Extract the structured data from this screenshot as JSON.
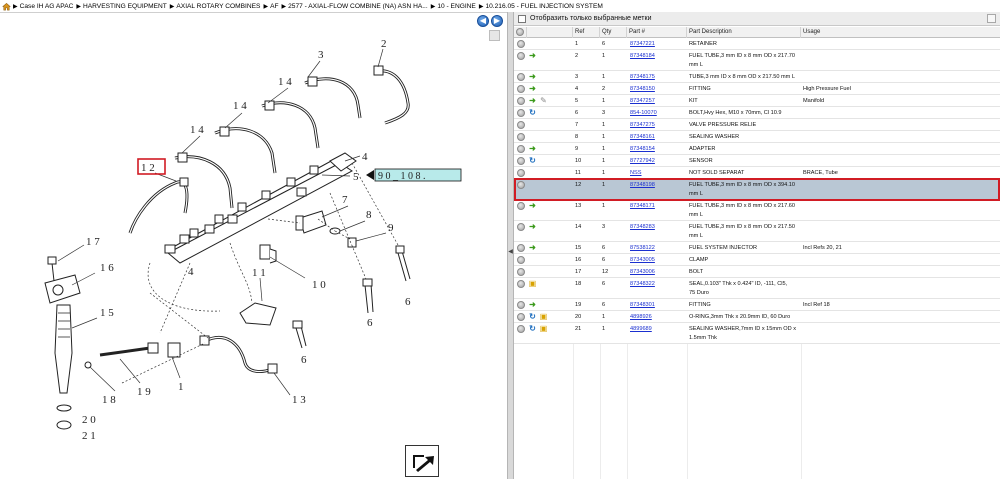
{
  "breadcrumb": {
    "items": [
      "Case IH AG APAC",
      "HARVESTING EQUIPMENT",
      "AXIAL ROTARY COMBINES",
      "AF",
      "2577 - AXIAL-FLOW COMBINE (NA) ASN HA...",
      "10 - ENGINE",
      "10.216.05 - FUEL INJECTION SYSTEM"
    ]
  },
  "diagram": {
    "callouts": {
      "c3": "3",
      "c2": "2",
      "c14a": "1 4",
      "c14b": "1 4",
      "c14c": "1 4",
      "c12": "1 2",
      "c5": "5",
      "c4a": "4",
      "c4b": "4",
      "c7": "7",
      "c8": "8",
      "c9": "9",
      "c17": "1 7",
      "c16": "1 6",
      "c15": "1 5",
      "c11": "1 1",
      "c10": "1 0",
      "c6a": "6",
      "c6b": "6",
      "c6c": "6",
      "c1": "1",
      "c19": "1 9",
      "c18": "1 8",
      "c13": "1 3",
      "c20": "2 0",
      "c21": "2 1"
    },
    "tag_label": "9 0 _ 1 0 8 .",
    "highlight_color": "#d11c24",
    "tag_fill": "#b8eaea"
  },
  "filter": {
    "label": "Отобразить только выбранные метки"
  },
  "table": {
    "columns": [
      "Ref",
      "Qty",
      "Part #",
      "Part Description",
      "Usage"
    ],
    "rows": [
      {
        "ref": "1",
        "qty": "6",
        "part": "87347221",
        "desc": "RETAINER",
        "desc2": "",
        "usage": "",
        "icons": []
      },
      {
        "ref": "2",
        "qty": "1",
        "part": "87348184",
        "desc": "FUEL TUBE,3 mm ID x 8 mm OD x 217.70",
        "desc2": "mm L",
        "usage": "",
        "icons": [
          "arrow"
        ]
      },
      {
        "ref": "3",
        "qty": "1",
        "part": "87348175",
        "desc": "TUBE,3 mm ID x 8 mm OD x 217.50 mm L",
        "desc2": "",
        "usage": "",
        "icons": [
          "arrow"
        ]
      },
      {
        "ref": "4",
        "qty": "2",
        "part": "87348150",
        "desc": "FITTING",
        "desc2": "",
        "usage": "High Pressure Fuel",
        "icons": [
          "arrow"
        ]
      },
      {
        "ref": "5",
        "qty": "1",
        "part": "87347257",
        "desc": "KIT",
        "desc2": "",
        "usage": "Manifold",
        "icons": [
          "arrow",
          "wrench"
        ]
      },
      {
        "ref": "6",
        "qty": "3",
        "part": "854-10070",
        "desc": "BOLT,Hvy Hex, M10 x 70mm, Cl 10.9",
        "desc2": "",
        "usage": "",
        "icons": [
          "swap"
        ]
      },
      {
        "ref": "7",
        "qty": "1",
        "part": "87347275",
        "desc": "VALVE PRESSURE RELIE",
        "desc2": "",
        "usage": "",
        "icons": []
      },
      {
        "ref": "8",
        "qty": "1",
        "part": "87348161",
        "desc": "SEALING WASHER",
        "desc2": "",
        "usage": "",
        "icons": []
      },
      {
        "ref": "9",
        "qty": "1",
        "part": "87348154",
        "desc": "ADAPTER",
        "desc2": "",
        "usage": "",
        "icons": [
          "arrow"
        ]
      },
      {
        "ref": "10",
        "qty": "1",
        "part": "87727942",
        "desc": "SENSOR",
        "desc2": "",
        "usage": "",
        "icons": [
          "swap"
        ]
      },
      {
        "ref": "11",
        "qty": "1",
        "part": "NSS",
        "desc": "NOT SOLD SEPARAT",
        "desc2": "",
        "usage": "BRACE, Tube",
        "icons": []
      },
      {
        "ref": "12",
        "qty": "1",
        "part": "87348198",
        "desc": "FUEL TUBE,3 mm ID x 8 mm OD x 394.10",
        "desc2": "mm L",
        "usage": "",
        "icons": [],
        "selected": true
      },
      {
        "ref": "13",
        "qty": "1",
        "part": "87348171",
        "desc": "FUEL TUBE,3 mm ID x 8 mm OD x 217.60",
        "desc2": "mm L",
        "usage": "",
        "icons": [
          "arrow"
        ]
      },
      {
        "ref": "14",
        "qty": "3",
        "part": "87348283",
        "desc": "FUEL TUBE,3 mm ID x 8 mm OD x 217.50",
        "desc2": "mm L",
        "usage": "",
        "icons": [
          "arrow"
        ]
      },
      {
        "ref": "15",
        "qty": "6",
        "part": "87538122",
        "desc": "FUEL SYSTEM INJECTOR",
        "desc2": "",
        "usage": "Incl Refs 20, 21",
        "icons": [
          "arrow"
        ]
      },
      {
        "ref": "16",
        "qty": "6",
        "part": "87343005",
        "desc": "CLAMP",
        "desc2": "",
        "usage": "",
        "icons": []
      },
      {
        "ref": "17",
        "qty": "12",
        "part": "87343006",
        "desc": "BOLT",
        "desc2": "",
        "usage": "",
        "icons": []
      },
      {
        "ref": "18",
        "qty": "6",
        "part": "87348322",
        "desc": "SEAL,0.103\" Thk x 0.424\" ID, -111, Cl5,",
        "desc2": "75 Duro",
        "usage": "",
        "icons": [
          "box"
        ]
      },
      {
        "ref": "19",
        "qty": "6",
        "part": "87348301",
        "desc": "FITTING",
        "desc2": "",
        "usage": "Incl Ref 18",
        "icons": [
          "arrow"
        ]
      },
      {
        "ref": "20",
        "qty": "1",
        "part": "4898926",
        "desc": "O-RING,3mm Thk x 20.9mm ID, 60 Duro",
        "desc2": "",
        "usage": "",
        "icons": [
          "swap",
          "box"
        ]
      },
      {
        "ref": "21",
        "qty": "1",
        "part": "4899689",
        "desc": "SEALING WASHER,7mm ID x 15mm OD x",
        "desc2": "1.5mm Thk",
        "usage": "",
        "icons": [
          "swap",
          "box"
        ]
      }
    ]
  },
  "colors": {
    "selection": "#b9c7d4",
    "highlight": "#d11c24",
    "link": "#1a2fd0"
  },
  "icons": {
    "arrow": "green-arrow-icon",
    "swap": "blue-swap-icon",
    "box": "yellow-box-icon",
    "wrench": "wrench-icon"
  }
}
